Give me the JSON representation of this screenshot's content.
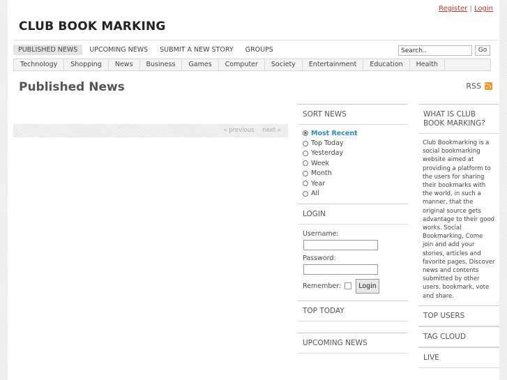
{
  "header": {
    "register_label": "Register",
    "separator": "|",
    "login_label": "Login",
    "site_title": "CLUB BOOK MARKING"
  },
  "main_nav": [
    "PUBLISHED NEWS",
    "UPCOMING NEWS",
    "SUBMIT A NEW STORY",
    "GROUPS"
  ],
  "search": {
    "value": "Search..",
    "button_label": "Go"
  },
  "categories": [
    "Technology",
    "Shopping",
    "News",
    "Business",
    "Games",
    "Computer",
    "Society",
    "Entertainment",
    "Education",
    "Health"
  ],
  "page": {
    "heading": "Published News",
    "rss_label": "RSS"
  },
  "pager": {
    "previous_label": "« previous",
    "next_label": "next »"
  },
  "sort_news": {
    "title": "SORT NEWS",
    "options": [
      "Most Recent",
      "Top Today",
      "Yesterday",
      "Week",
      "Month",
      "Year",
      "All"
    ],
    "selected": "Most Recent"
  },
  "login": {
    "title": "LOGIN",
    "username_label": "Username:",
    "password_label": "Password:",
    "remember_label": "Remember:",
    "button_label": "Login"
  },
  "top_today": {
    "title": "TOP TODAY"
  },
  "upcoming_news": {
    "title": "UPCOMING NEWS"
  },
  "about": {
    "title": "WHAT IS CLUB BOOK MARKING?",
    "text": "Club Bookmarking is a social bookmarking website aimed at providing a platform to the users for sharing their bookmarks with the world, in such a manner, that the original source gets advantage to their good works. Social Bookmarking, Come join and add your stories, articles and favorite pages, Discover news and contents submitted by other users. bookmark, vote and share."
  },
  "top_users": {
    "title": "TOP USERS"
  },
  "tag_cloud": {
    "title": "TAG CLOUD"
  },
  "live": {
    "title": "LIVE"
  },
  "colors": {
    "link_red": "#c0392b",
    "selected_blue": "#2b8cb5",
    "rss_orange": "#f7931e"
  }
}
